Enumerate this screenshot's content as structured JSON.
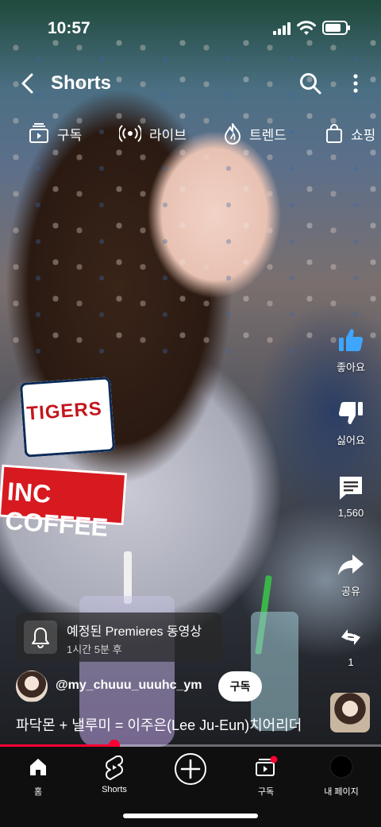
{
  "status_bar": {
    "time": "10:57",
    "battery_level": 0.8
  },
  "header": {
    "title": "Shorts",
    "back_icon": "chevron-left-icon",
    "search_icon": "search-icon",
    "more_icon": "more-vert-icon"
  },
  "chips": [
    {
      "label": "구독",
      "icon": "subscriptions-icon"
    },
    {
      "label": "라이브",
      "icon": "live-icon"
    },
    {
      "label": "트렌드",
      "icon": "trending-icon"
    },
    {
      "label": "쇼핑",
      "icon": "shopping-bag-icon"
    }
  ],
  "actions": {
    "like_label": "좋아요",
    "dislike_label": "싫어요",
    "comment_count": "1,560",
    "share_label": "공유",
    "remix_count": "1"
  },
  "premiere": {
    "title": "예정된 Premieres 동영상",
    "subtitle": "1시간 5분 후"
  },
  "channel": {
    "handle": "@my_chuuu_uuuhc_ym",
    "subscribe_label": "구독"
  },
  "video": {
    "title": "파닥몬 + 낼루미 = 이주은(Lee Ju-Eun)치어리더",
    "progress": 0.3
  },
  "overlay_text": {
    "patch": "TIGERS",
    "sleeve": "INC COFFEE"
  },
  "bottom_nav": [
    {
      "label": "홈",
      "icon": "home-icon"
    },
    {
      "label": "Shorts",
      "icon": "shorts-icon"
    },
    {
      "label": "",
      "icon": "create-icon"
    },
    {
      "label": "구독",
      "icon": "subscriptions-icon"
    },
    {
      "label": "내 페이지",
      "icon": "profile-avatar-icon"
    }
  ],
  "colors": {
    "accent": "#ff0033",
    "like_blue": "#3ea6ff",
    "nav_bg": "#0f0f0f"
  }
}
